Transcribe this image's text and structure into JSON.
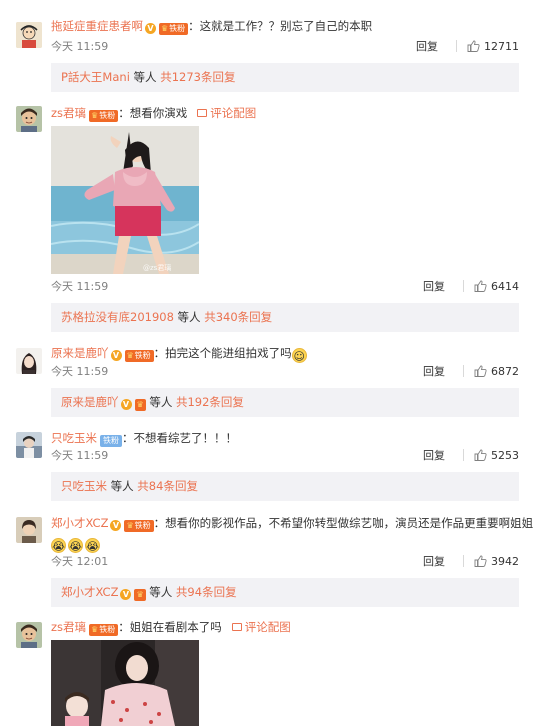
{
  "comments": [
    {
      "username": "拖延症重症患者啊",
      "fan_badge": "铁粉",
      "text": "：这就是工作？？别忘了自己的本职",
      "time": "今天 11:59",
      "reply_label": "回复",
      "likes": "12711",
      "replies": {
        "name": "P話大王Mani",
        "join": " 等人",
        "count": " 共1273条回复"
      }
    },
    {
      "username": "zs君璃",
      "fan_badge": "铁粉",
      "text": "：想看你演戏",
      "pic_link": "评论配图",
      "watermark": "@zs君璃",
      "time": "今天 11:59",
      "reply_label": "回复",
      "likes": "6414",
      "replies": {
        "name": "苏格拉没有底201908",
        "join": " 等人",
        "count": " 共340条回复"
      }
    },
    {
      "username": "原来是鹿吖",
      "fan_badge": "铁粉",
      "text": "：拍完这个能进组拍戏了吗",
      "time": "今天 11:59",
      "reply_label": "回复",
      "likes": "6872",
      "replies": {
        "name": "原来是鹿吖",
        "join": " 等人",
        "count": " 共192条回复"
      }
    },
    {
      "username": "只吃玉米",
      "fan_badge": "铁粉",
      "text": "：不想看综艺了！！！",
      "time": "今天 11:59",
      "reply_label": "回复",
      "likes": "5253",
      "replies": {
        "name": "只吃玉米",
        "join": " 等人",
        "count": " 共84条回复"
      }
    },
    {
      "username": "郑小才XCZ",
      "fan_badge": "铁粉",
      "text": "：想看你的影视作品，不希望你转型做综艺咖，演员还是作品更重要啊姐姐",
      "time": "今天 12:01",
      "reply_label": "回复",
      "likes": "3942",
      "replies": {
        "name": "郑小才XCZ",
        "join": " 等人",
        "count": " 共94条回复"
      }
    },
    {
      "username": "zs君璃",
      "fan_badge": "铁粉",
      "text": "：姐姐在看剧本了吗",
      "pic_link": "评论配图"
    }
  ],
  "colors": {
    "username": "#eb7350",
    "reply_box_bg": "#f2f2f5",
    "meta_text": "#808080",
    "fan_badge": "#f06a26",
    "verified_badge": "#f5a623",
    "tie_badge": "#79b1e9"
  },
  "icons": [
    "verified-v-icon",
    "fan-badge-icon",
    "picture-icon",
    "like-thumb-icon",
    "smile-emoji-icon",
    "cry-emoji-icon"
  ]
}
